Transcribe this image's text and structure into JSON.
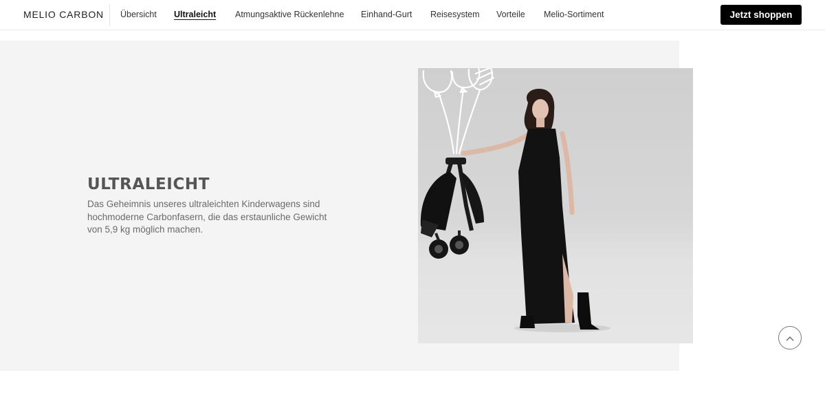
{
  "header": {
    "brand": "MELIO CARBON",
    "nav": [
      {
        "label": "Übersicht",
        "active": false
      },
      {
        "label": "Ultraleicht",
        "active": true
      },
      {
        "label": "Atmungsaktive Rückenlehne",
        "active": false
      },
      {
        "label": "Einhand-Gurt",
        "active": false
      },
      {
        "label": "Reisesystem",
        "active": false
      },
      {
        "label": "Vorteile",
        "active": false
      },
      {
        "label": "Melio-Sortiment",
        "active": false
      }
    ],
    "cta_label": "Jetzt shoppen"
  },
  "section": {
    "title": "ULTRALEICHT",
    "description": "Das Geheimnis unseres ultraleichten Kinderwagens sind hochmoderne Carbonfasern, die das erstaunliche Gewicht von 5,9 kg möglich machen."
  },
  "image": {
    "subject": "model-with-folded-stroller-and-balloons",
    "icon": "scroll-to-top-chevron-up-icon"
  },
  "colors": {
    "cta_background": "#000000",
    "panel_background": "#f4f4f4",
    "heading": "#555555"
  }
}
